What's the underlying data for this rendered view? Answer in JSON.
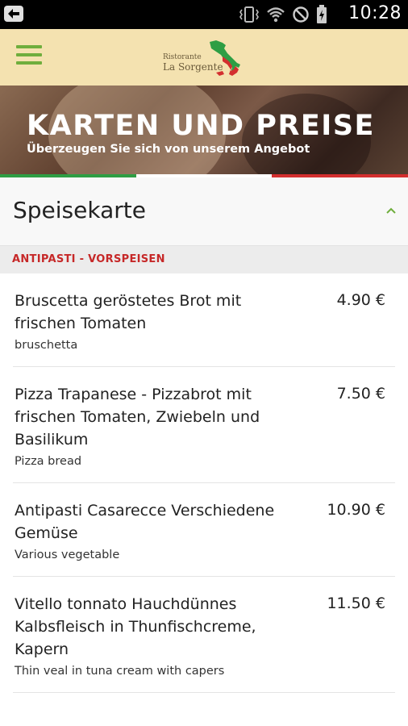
{
  "status_bar": {
    "time": "10:28",
    "icons": [
      "back-arrow-icon",
      "vibrate-icon",
      "wifi-icon",
      "no-disturb-icon",
      "battery-charging-icon"
    ]
  },
  "app_bar": {
    "logo_line_1": "Ristorante",
    "logo_line_2": "La Sorgente",
    "colors": {
      "background": "#f4e2b0",
      "menu_icon": "#6fae3d"
    }
  },
  "banner": {
    "title": "KARTEN UND PREISE",
    "subtitle": "Überzeugen Sie sich von unserem Angebot",
    "flag_colors": [
      "#2e9e44",
      "#ffffff",
      "#d32f2f"
    ]
  },
  "menu": {
    "title": "Speisekarte",
    "category": "ANTIPASTI - VORSPEISEN",
    "items": [
      {
        "name": "Bruscetta geröstetes Brot mit frischen Tomaten",
        "desc": "bruschetta",
        "price": "4.90 €"
      },
      {
        "name": "Pizza Trapanese - Pizzabrot mit frischen Tomaten, Zwiebeln und Basilikum",
        "desc": "Pizza bread",
        "price": "7.50 €"
      },
      {
        "name": "Antipasti Casarecce Verschiedene Gemüse",
        "desc": "Various vegetable",
        "price": "10.90 €"
      },
      {
        "name": "Vitello tonnato Hauchdünnes Kalbsfleisch in Thunfischcreme, Kapern",
        "desc": "Thin veal in tuna cream with capers",
        "price": "11.50 €"
      }
    ]
  }
}
